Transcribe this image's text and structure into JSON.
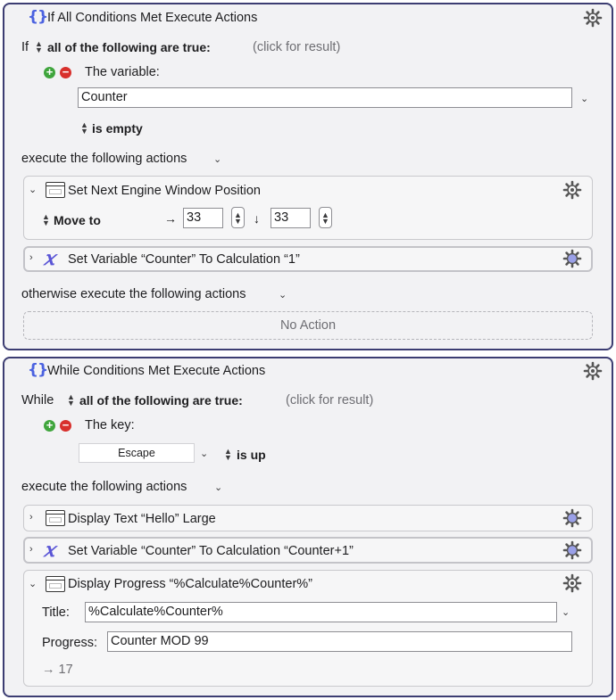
{
  "if_block": {
    "title": "If All Conditions Met Execute Actions",
    "if_label": "If",
    "condition_mode": "all of the following are true:",
    "click_for_result": "(click for result)",
    "condition_type": "The variable:",
    "variable_value": "Counter",
    "operator": "is empty",
    "execute_label": "execute the following actions",
    "actions": [
      {
        "title": "Set Next Engine Window Position",
        "icon": "window-icon"
      },
      {
        "title": "Set Variable “Counter” To Calculation “1”",
        "icon": "variable-x-icon"
      }
    ],
    "move_to_label": "Move to",
    "move_x": "33",
    "move_y": "33",
    "arrow_right": "→",
    "arrow_down": "↓",
    "otherwise_label": "otherwise execute the following actions",
    "no_action": "No Action"
  },
  "while_block": {
    "title": "While Conditions Met Execute Actions",
    "while_label": "While",
    "condition_mode": "all of the following are true:",
    "click_for_result": "(click for result)",
    "condition_type": "The key:",
    "key_value": "Escape",
    "key_state": "is up",
    "execute_label": "execute the following actions",
    "actions": [
      {
        "title": "Display Text “Hello” Large",
        "icon": "window-icon"
      },
      {
        "title": "Set Variable “Counter” To Calculation “Counter+1”",
        "icon": "variable-x-icon"
      },
      {
        "title": "Display Progress “%Calculate%Counter%”",
        "icon": "window-icon"
      }
    ],
    "progress_title_label": "Title:",
    "progress_title_value": "%Calculate%Counter%",
    "progress_label": "Progress:",
    "progress_value": "Counter MOD 99",
    "result_text": "→ 17"
  },
  "colors": {
    "block_border": "#3c3d72",
    "brace_accent": "#4b62e0",
    "variable_icon": "#5a55d6",
    "add_green": "#3fa53c",
    "remove_red": "#d8302c"
  }
}
